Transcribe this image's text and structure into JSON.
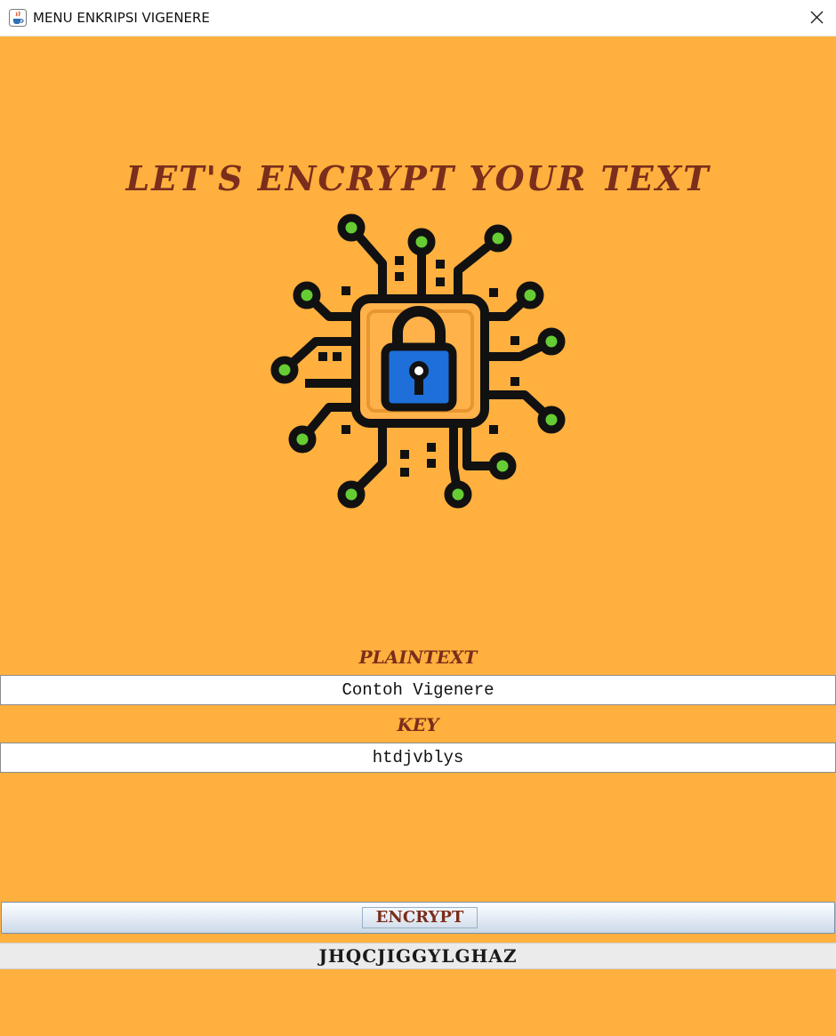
{
  "window": {
    "title": "MENU ENKRIPSI VIGENERE",
    "app_icon": "java-cup-icon",
    "close_icon": "close-icon"
  },
  "heading": "LET'S ENCRYPT YOUR TEXT",
  "illustration": {
    "icon": "circuit-padlock-icon"
  },
  "plaintext": {
    "label": "PLAINTEXT",
    "value": "Contoh Vigenere"
  },
  "key": {
    "label": "KEY",
    "value": "htdjvblys"
  },
  "encrypt_button": {
    "label": "ENCRYPT"
  },
  "result": {
    "value": "JHQCJIGGYLGHAZ"
  },
  "colors": {
    "background": "#FFB03E",
    "label_text": "#7B2E1B",
    "lock_body": "#1E6FD9",
    "node_fill": "#66CC33",
    "chip_fill": "#FFB24A"
  }
}
